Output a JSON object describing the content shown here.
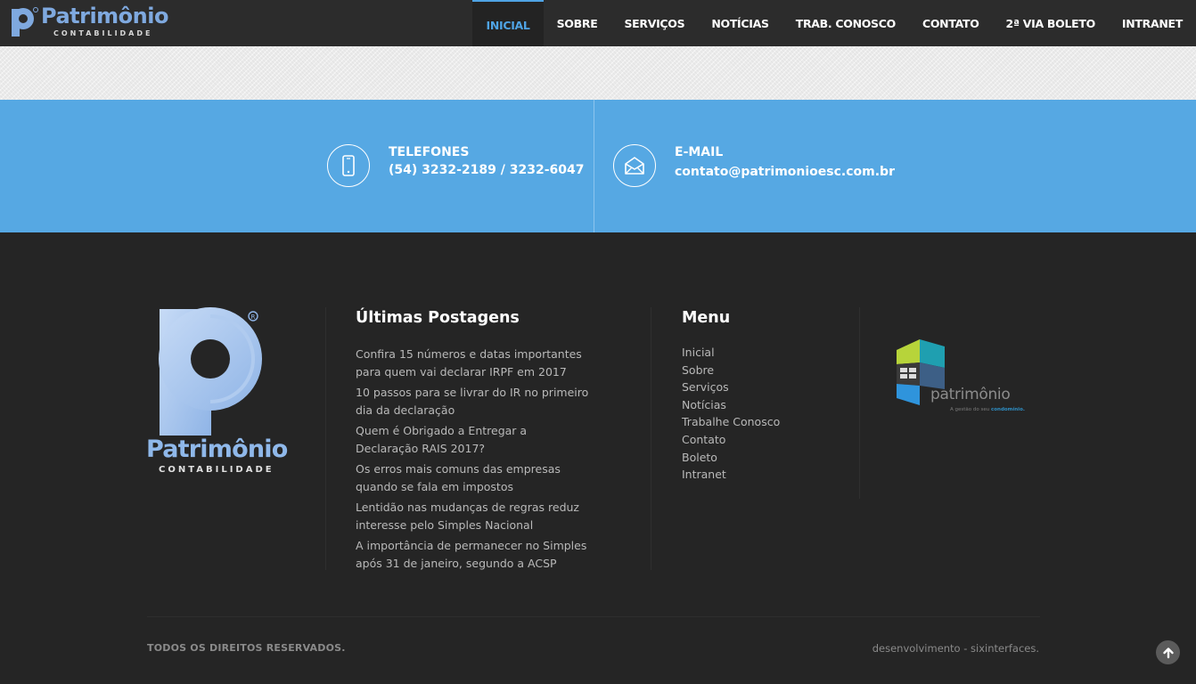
{
  "header": {
    "logo_name": "Patrimônio",
    "logo_sub": "CONTABILIDADE",
    "nav": [
      "INICIAL",
      "SOBRE",
      "SERVIÇOS",
      "NOTÍCIAS",
      "TRAB. CONOSCO",
      "CONTATO",
      "2ª VIA BOLETO",
      "INTRANET"
    ],
    "active_index": 0
  },
  "contact": {
    "phone_title": "TELEFONES",
    "phone_value": "(54) 3232-2189 / 3232-6047",
    "email_title": "E-MAIL",
    "email_value": "contato@patrimonioesc.com.br",
    "phone_icon": "smartphone-icon",
    "email_icon": "envelope-open-icon"
  },
  "footer": {
    "logo_name": "Patrimônio",
    "logo_sub": "CONTABILIDADE",
    "posts_title": "Últimas Postagens",
    "posts": [
      "Confira 15 números e datas importantes para quem vai declarar IRPF em 2017",
      "10 passos para se livrar do IR no primeiro dia da declaração",
      "Quem é Obrigado a Entregar a Declaração RAIS 2017?",
      "Os erros mais comuns das empresas quando se fala em impostos",
      "Lentidão nas mudanças de regras reduz interesse pelo Simples Nacional",
      "A importância de permanecer no Simples após 31 de janeiro, segundo a ACSP"
    ],
    "menu_title": "Menu",
    "menu": [
      "Inicial",
      "Sobre",
      "Serviços",
      "Notícias",
      "Trabalhe Conosco",
      "Contato",
      "Boleto",
      "Intranet"
    ],
    "partner_name": "patrimônio",
    "partner_tag_prefix": "A gestão do seu ",
    "partner_tag_bold": "condomínio.",
    "copyright": "TODOS OS DIREITOS RESERVADOS.",
    "credits": "desenvolvimento - sixinterfaces."
  },
  "colors": {
    "accent": "#4fa3e4",
    "contact_band": "#56a8e3",
    "footer_bg": "#252525",
    "navbar_bg": "#2c2c2c"
  }
}
